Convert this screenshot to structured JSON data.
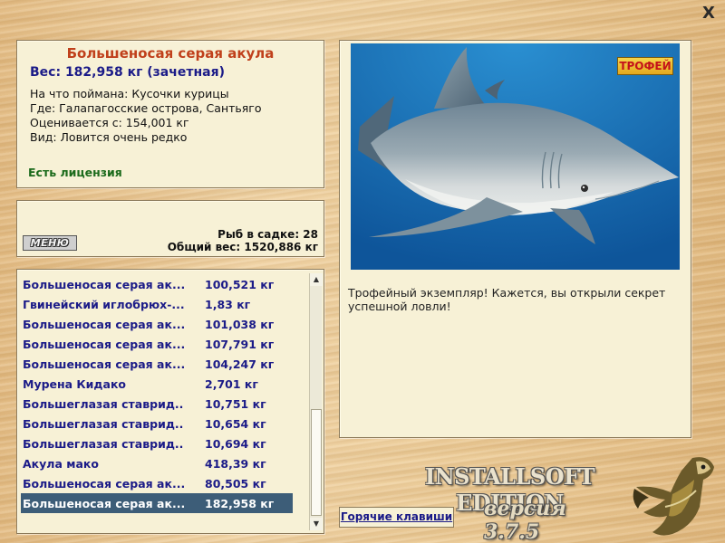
{
  "close_label": "X",
  "fish": {
    "title": "Большеносая серая акула",
    "weight_line": "Вес: 182,958 кг (зачетная)",
    "caught_on": "На что поймана: Кусочки курицы",
    "place": "Где: Галапагосские острова, Сантьяго",
    "value": "Оценивается с: 154,001 кг",
    "kind": "Вид: Ловится очень редко",
    "license": "Есть лицензия"
  },
  "stats": {
    "menu_label": "МЕНЮ",
    "net_count": "Рыб в садке: 28",
    "total_weight": "Общий вес: 1520,886 кг"
  },
  "catch_list": [
    {
      "name": "Большеносая серая ак...",
      "weight": "100,521 кг"
    },
    {
      "name": "Гвинейский иглобрюх-...",
      "weight": "1,83 кг"
    },
    {
      "name": "Большеносая серая ак...",
      "weight": "101,038 кг"
    },
    {
      "name": "Большеносая серая ак...",
      "weight": "107,791 кг"
    },
    {
      "name": "Большеносая серая ак...",
      "weight": "104,247 кг"
    },
    {
      "name": "Мурена Кидако",
      "weight": "2,701 кг"
    },
    {
      "name": "Большеглазая ставрид...",
      "weight": "10,751 кг"
    },
    {
      "name": "Большеглазая ставрид...",
      "weight": "10,654 кг"
    },
    {
      "name": "Большеглазая ставрид...",
      "weight": "10,694 кг"
    },
    {
      "name": "Акула мако",
      "weight": "418,39 кг"
    },
    {
      "name": "Большеносая серая ак...",
      "weight": "80,505 кг"
    },
    {
      "name": "Большеносая серая ак...",
      "weight": "182,958 кг",
      "selected": true
    }
  ],
  "photo": {
    "badge": "ТРОФЕЙ",
    "message": "Трофейный экземпляр! Кажется, вы открыли секрет успешной ловли!"
  },
  "hotkeys_label": "Горячие клавиши",
  "brand": {
    "name": "INSTALLSOFT EDITION",
    "version": "версия 3.7.5"
  },
  "colors": {
    "title": "#c0401b",
    "weight": "#1b1b88",
    "license": "#1b6a1b",
    "selected_row": "#3d5d78",
    "panel": "#f7f1d6"
  }
}
